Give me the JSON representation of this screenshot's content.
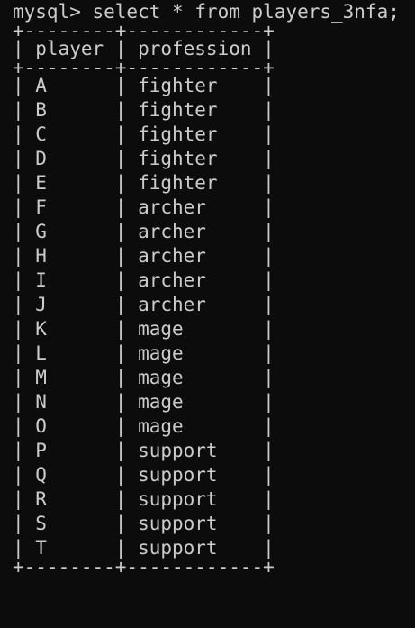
{
  "colors": {
    "background": "#0c0c0c",
    "text": "#cccccc"
  },
  "prompt": "mysql> select * from players_3nfa;",
  "table": {
    "border": "+--------+------------+",
    "header": "| player | profession |",
    "rows": [
      "| A      | fighter    |",
      "| B      | fighter    |",
      "| C      | fighter    |",
      "| D      | fighter    |",
      "| E      | fighter    |",
      "| F      | archer     |",
      "| G      | archer     |",
      "| H      | archer     |",
      "| I      | archer     |",
      "| J      | archer     |",
      "| K      | mage       |",
      "| L      | mage       |",
      "| M      | mage       |",
      "| N      | mage       |",
      "| O      | mage       |",
      "| P      | support    |",
      "| Q      | support    |",
      "| R      | support    |",
      "| S      | support    |",
      "| T      | support    |"
    ]
  }
}
